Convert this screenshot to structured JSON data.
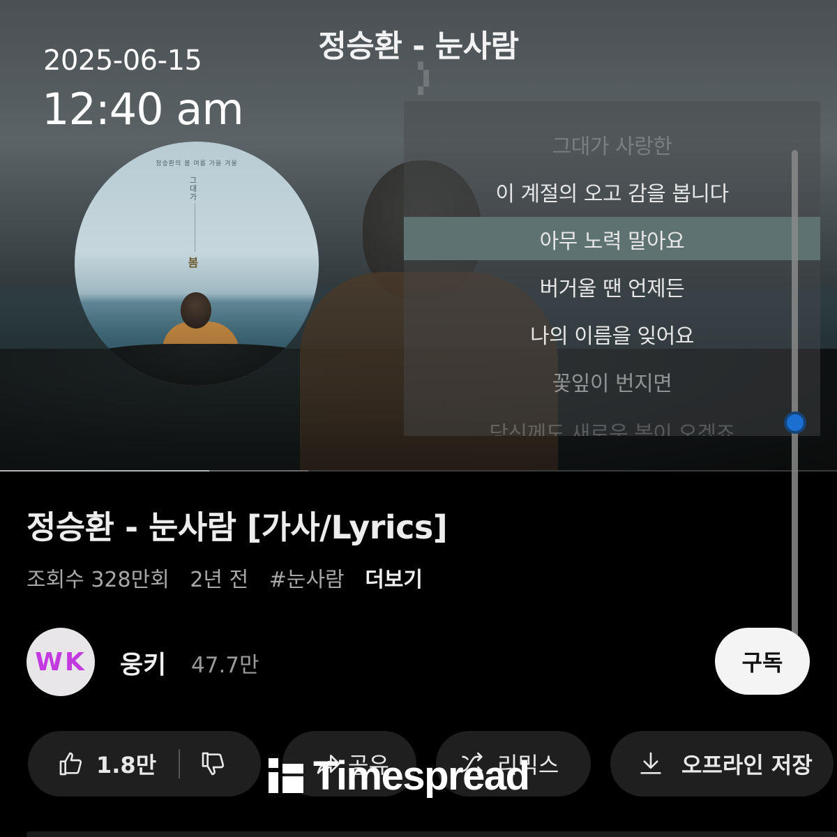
{
  "overlay": {
    "date": "2025-06-15",
    "time": "12:40 am"
  },
  "video": {
    "title": "정승환 - 눈사람",
    "album": {
      "subtitle": "정승환의 봄 여름 가을 겨울",
      "vertical_text": "그 대 가",
      "char": "봄"
    },
    "lyrics": [
      "그대가 사랑한",
      "이 계절의 오고 감을 봅니다",
      "아무 노력 말아요",
      "버거울 땐 언제든",
      "나의 이름을 잊어요",
      "꽃잎이 번지면",
      "당신께도 새로운 봄이 오겠죠"
    ],
    "active_lyric_index": 2,
    "progress_played": 0.25,
    "progress_buffered": 0.368
  },
  "info": {
    "title": "정승환 - 눈사람 [가사/Lyrics]",
    "views": "조회수 328만회",
    "age": "2년 전",
    "hashtag": "#눈사람",
    "more": "더보기"
  },
  "channel": {
    "avatar_text": "WK",
    "avatar_color": "#c33be0",
    "name": "웅키",
    "subscribers": "47.7만",
    "subscribe_label": "구독"
  },
  "actions": {
    "like_count": "1.8만",
    "share_label": "공유",
    "remix_label": "리믹스",
    "offline_label": "오프라인 저장",
    "icons": [
      "thumbs-up-icon",
      "thumbs-down-icon",
      "share-icon",
      "remix-icon",
      "download-icon"
    ]
  },
  "watermark": {
    "text": "Timespread"
  },
  "colors": {
    "accent_blue": "#1b6fd1",
    "lyric_highlight": "#5f7272",
    "pill_bg": "#1f1f1f"
  }
}
